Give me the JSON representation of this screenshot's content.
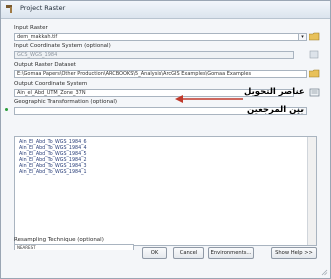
{
  "window": {
    "title": "Project Raster",
    "accent": "#c0392b"
  },
  "fields": {
    "input_raster_label": "Input Raster",
    "input_raster_value": "dem_makkah.tif",
    "input_crs_label": "Input Coordinate System (optional)",
    "input_crs_value": "GCS_WGS_1984",
    "output_raster_label": "Output Raster Dataset",
    "output_raster_value": "E:\\Gomaa Papers\\Other Production\\ARCBOOKS\\5_Analysis\\ArcGIS Examples\\Gomaa Examples",
    "output_crs_label": "Output Coordinate System",
    "output_crs_value": "Ain_el_Abd_UTM_Zone_37N",
    "geo_transform_label": "Geographic Transformation (optional)"
  },
  "transformations": [
    "Ain_El_Abd_To_WGS_1984_6",
    "Ain_El_Abd_To_WGS_1984_4",
    "Ain_El_Abd_To_WGS_1984_5",
    "Ain_El_Abd_To_WGS_1984_2",
    "Ain_El_Abd_To_WGS_1984_3",
    "Ain_El_Abd_To_WGS_1984_1"
  ],
  "resampling": {
    "label": "Resampling Technique (optional)",
    "value": "NEAREST"
  },
  "annotation": {
    "line1": "عناصر التحويل",
    "line2": "بين المرجعين"
  },
  "buttons": {
    "ok": "OK",
    "cancel": "Cancel",
    "environments": "Environments...",
    "help": "Show Help >>"
  }
}
